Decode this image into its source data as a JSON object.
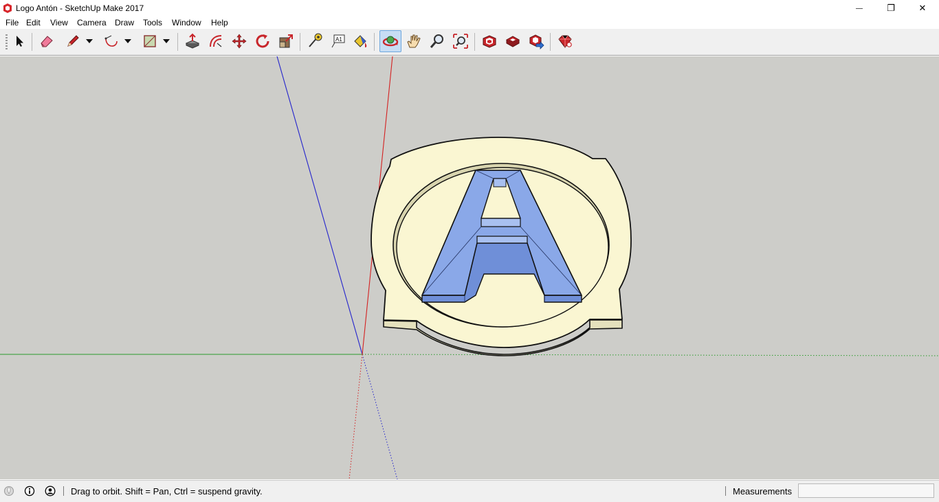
{
  "window": {
    "title": "Logo Antón - SketchUp Make 2017",
    "minimize_glyph": "—",
    "restore_glyph": "❐",
    "close_glyph": "✕"
  },
  "menu": {
    "items": [
      "File",
      "Edit",
      "View",
      "Camera",
      "Draw",
      "Tools",
      "Window",
      "Help"
    ]
  },
  "toolbar": {
    "tools": [
      {
        "name": "select-tool",
        "icon": "arrow-cursor-icon"
      },
      {
        "name": "eraser-tool",
        "icon": "eraser-icon"
      },
      {
        "name": "line-tool",
        "icon": "pencil-icon"
      },
      {
        "name": "arc-tool",
        "icon": "arc-icon"
      },
      {
        "name": "rectangle-tool",
        "icon": "rectangle-icon"
      },
      {
        "name": "push-pull-tool",
        "icon": "push-pull-icon"
      },
      {
        "name": "offset-tool",
        "icon": "offset-icon"
      },
      {
        "name": "move-tool",
        "icon": "move-arrows-icon"
      },
      {
        "name": "rotate-tool",
        "icon": "rotate-icon"
      },
      {
        "name": "scale-tool",
        "icon": "scale-icon"
      },
      {
        "name": "tape-measure-tool",
        "icon": "tape-measure-icon"
      },
      {
        "name": "text-tool",
        "icon": "text-label-icon"
      },
      {
        "name": "paint-bucket-tool",
        "icon": "paint-bucket-icon"
      },
      {
        "name": "orbit-tool",
        "icon": "orbit-icon",
        "active": true
      },
      {
        "name": "pan-tool",
        "icon": "hand-icon"
      },
      {
        "name": "zoom-tool",
        "icon": "magnifier-icon"
      },
      {
        "name": "zoom-extents-tool",
        "icon": "zoom-extents-icon"
      },
      {
        "name": "3d-warehouse-tool",
        "icon": "3d-warehouse-icon"
      },
      {
        "name": "extension-warehouse-tool",
        "icon": "extension-warehouse-icon"
      },
      {
        "name": "share-model-tool",
        "icon": "share-model-icon"
      },
      {
        "name": "ruby-console-tool",
        "icon": "ruby-gem-icon"
      }
    ],
    "text_tool_glyph": "A1"
  },
  "viewport": {
    "background": "#cdcdc9",
    "axis_colors": {
      "red": "#d42020",
      "green": "#2a9a2a",
      "blue": "#2323cc"
    },
    "model": {
      "ring_color": "#faf6d2",
      "letter_color": "#8aa8e8",
      "letter_dark": "#6f8fd8"
    }
  },
  "status": {
    "message": "Drag to orbit. Shift = Pan, Ctrl = suspend gravity.",
    "measurements_label": "Measurements",
    "measurements_value": ""
  },
  "colors": {
    "accent": "#6ea7dd",
    "active_bg": "#c7ddf4"
  }
}
